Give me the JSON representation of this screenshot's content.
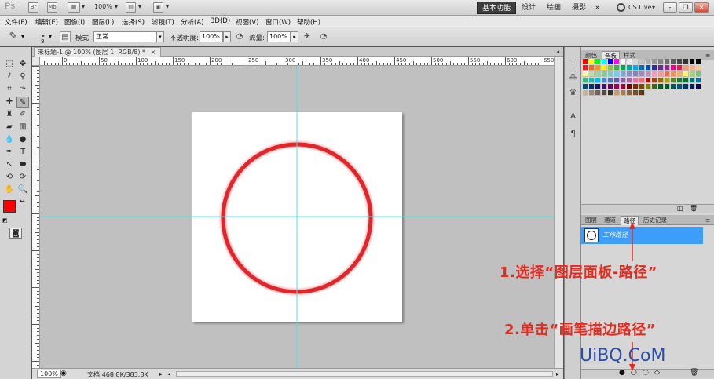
{
  "app": {
    "logo": "Ps",
    "icon_br": "Br",
    "icon_mb": "Mb",
    "zoom_display": "100%",
    "workspaces": [
      "基本功能",
      "设计",
      "绘画",
      "摄影"
    ],
    "more": "»",
    "cs_live": "CS Live",
    "win_min": "-",
    "win_restore": "❐",
    "win_close": "✕"
  },
  "menu": [
    "文件(F)",
    "编辑(E)",
    "图像(I)",
    "图层(L)",
    "选择(S)",
    "滤镜(T)",
    "分析(A)",
    "3D(D)",
    "视图(V)",
    "窗口(W)",
    "帮助(H)"
  ],
  "options": {
    "brush_size": "8",
    "mode_label": "模式:",
    "mode_value": "正常",
    "opacity_label": "不透明度:",
    "opacity_value": "100%",
    "flow_label": "流量:",
    "flow_value": "100%"
  },
  "document": {
    "tab_title": "未标题-1 @ 100% (图层 1, RGB/8) *",
    "close": "×",
    "ruler_labels": [
      "50",
      "0",
      "50",
      "100",
      "150",
      "200",
      "250",
      "300",
      "350",
      "400",
      "450",
      "500",
      "550",
      "600",
      "650"
    ],
    "status_zoom": "100%",
    "status_doc": "文档:468.8K/383.8K"
  },
  "colors": {
    "foreground": "#ff0000",
    "background": "#ffffff",
    "circle": "#e0262a",
    "guide": "#3ee7ee",
    "path_selected": "#3d9dfb",
    "annotation": "#e52b20"
  },
  "panels": {
    "top_tabs": [
      "颜色",
      "色板",
      "样式"
    ],
    "top_active": 1,
    "bottom_tabs": [
      "图层",
      "通道",
      "路径",
      "历史记录"
    ],
    "bottom_active": 2,
    "path_name": "工作路径"
  },
  "annotations": {
    "step1": "1.选择“图层面板-路径”",
    "step2": "2.单击“画笔描边路径”"
  },
  "watermark": "UiBQ.CoM"
}
